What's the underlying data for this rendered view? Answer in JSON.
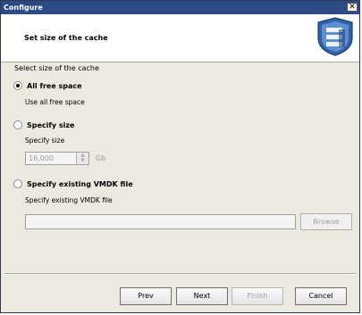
{
  "window": {
    "title": "Configure",
    "close_glyph": "✕"
  },
  "header": {
    "title": "Set size of the cache",
    "logo_icon": "product-logo-icon"
  },
  "section_label": "Select size of the cache",
  "options": [
    {
      "label": "All free space",
      "checked": true,
      "description": "Use all free space"
    },
    {
      "label": "Specify size",
      "checked": false,
      "description": "Specify size"
    },
    {
      "label": "Specify existing VMDK file",
      "checked": false,
      "description": "Specify existing VMDK file"
    }
  ],
  "size_field": {
    "value": "16,000",
    "unit": "Gb",
    "up": "▲",
    "down": "▼"
  },
  "vmdk": {
    "path_value": "",
    "browse_label": "Browse"
  },
  "buttons": {
    "prev": "Prev",
    "next": "Next",
    "finish": "Finish",
    "cancel": "Cancel"
  }
}
